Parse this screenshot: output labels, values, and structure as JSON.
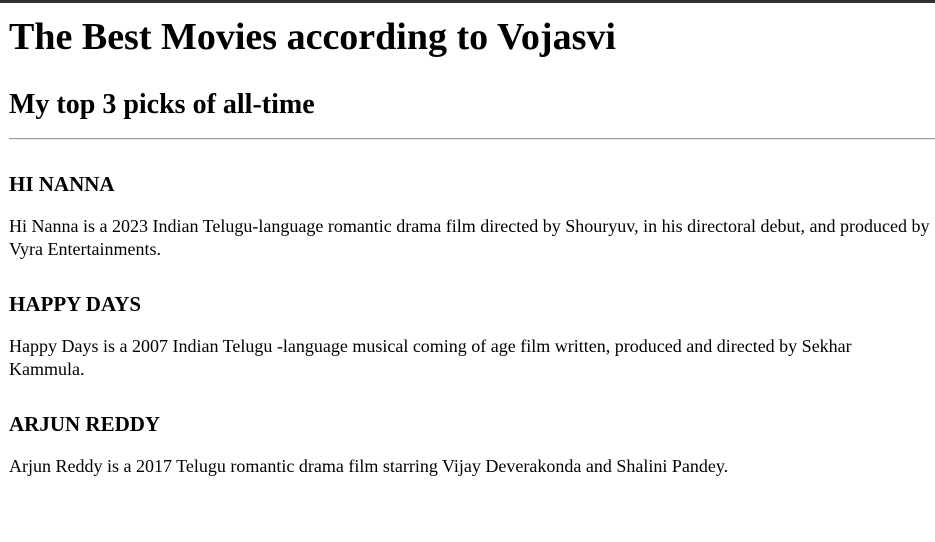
{
  "page": {
    "title": "The Best Movies according to Vojasvi",
    "subtitle": "My top 3 picks of all-time"
  },
  "movies": [
    {
      "name": "HI NANNA",
      "description": "Hi Nanna is a 2023 Indian Telugu-language romantic drama film directed by Shouryuv, in his directoral debut, and produced by Vyra Entertainments."
    },
    {
      "name": "HAPPY DAYS",
      "description": "Happy Days is a 2007 Indian Telugu -language musical coming of age film written, produced and directed by Sekhar Kammula."
    },
    {
      "name": "ARJUN REDDY",
      "description": "Arjun Reddy is a 2017 Telugu romantic drama film starring Vijay Deverakonda and Shalini Pandey."
    }
  ]
}
